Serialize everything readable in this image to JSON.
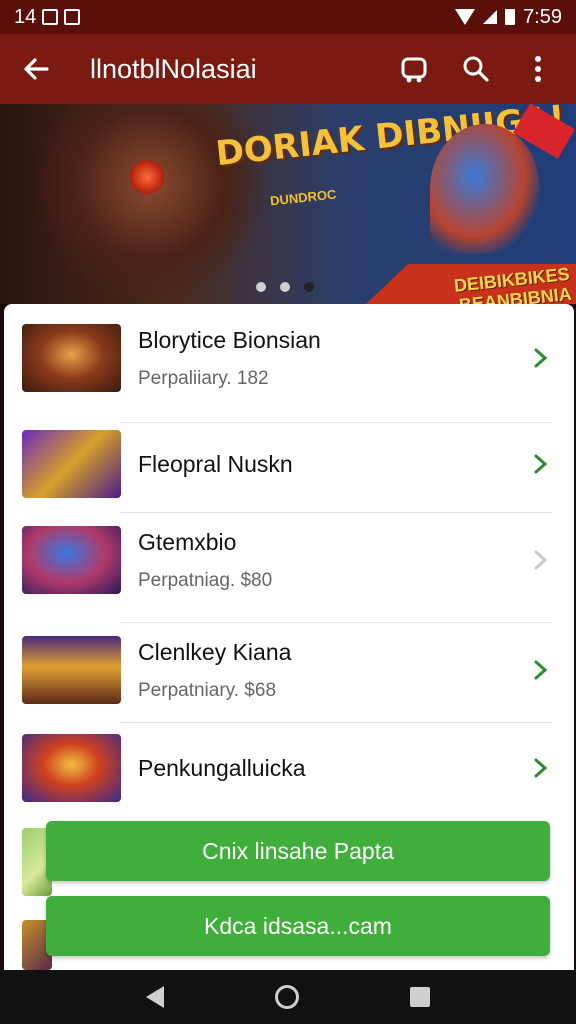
{
  "status_bar": {
    "time_left": "14",
    "time_right": "7:59"
  },
  "app_bar": {
    "back_label": "←",
    "title": "llnotblNolasiai"
  },
  "banner": {
    "title": "DORIAK DIBNIIGA!",
    "subtitle": "DUNDROC",
    "promo": "DEIBIKBIKES BEANBIBNIA KIOPIBI",
    "slide_count": 3,
    "active_slide": 3
  },
  "list": {
    "items": [
      {
        "title": "Blorytice Bionsian",
        "subtitle": "Perpaliiary. 182",
        "chevron_active": true
      },
      {
        "title": "Fleopral Nuskn",
        "subtitle": "",
        "chevron_active": true
      },
      {
        "title": "Gtemxbio",
        "subtitle": "Perpatniag. $80",
        "chevron_active": false
      },
      {
        "title": "Clenlkey Kiana",
        "subtitle": "Perpatniary. $68",
        "chevron_active": true
      },
      {
        "title": "Penkungalluicka",
        "subtitle": "",
        "chevron_active": true
      }
    ]
  },
  "buttons": {
    "primary": "Cnix linsahe Papta",
    "secondary": "Kdca idsasa...cam"
  },
  "colors": {
    "app_bar": "#7a1a10",
    "status_bar": "#5a0f0a",
    "accent_green": "#3fae3a",
    "chevron_green": "#2e8b2e"
  },
  "icons": {
    "back": "arrow-left-icon",
    "cart": "cart-icon",
    "search": "search-icon",
    "more": "more-vert-icon",
    "chevron": "chevron-right-icon"
  }
}
